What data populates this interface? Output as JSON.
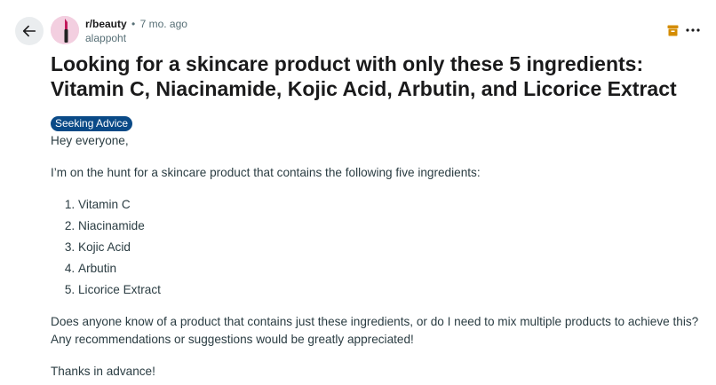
{
  "post": {
    "subreddit": "r/beauty",
    "separator": "•",
    "time_ago": "7 mo. ago",
    "author": "alappoht",
    "title": "Looking for a skincare product with only these 5 ingredients: Vitamin C, Niacinamide, Kojic Acid, Arbutin, and Licorice Extract",
    "flair": "Seeking Advice",
    "body": {
      "greeting": "Hey everyone,",
      "intro": "I’m on the hunt for a skincare product that contains the following five ingredients:",
      "ingredients": [
        "Vitamin C",
        "Niacinamide",
        "Kojic Acid",
        "Arbutin",
        "Licorice Extract"
      ],
      "question": "Does anyone know of a product that contains just these ingredients, or do I need to mix multiple products to achieve this? Any recommendations or suggestions would be greatly appreciated!",
      "closing": "Thanks in advance!"
    }
  },
  "icons": {
    "back": "arrow-left-icon",
    "archive": "archive-icon",
    "more": "more-horizontal-icon"
  },
  "colors": {
    "flair_bg": "#0a4a87",
    "archive": "#d48c00",
    "back_bg": "#eaedef"
  }
}
